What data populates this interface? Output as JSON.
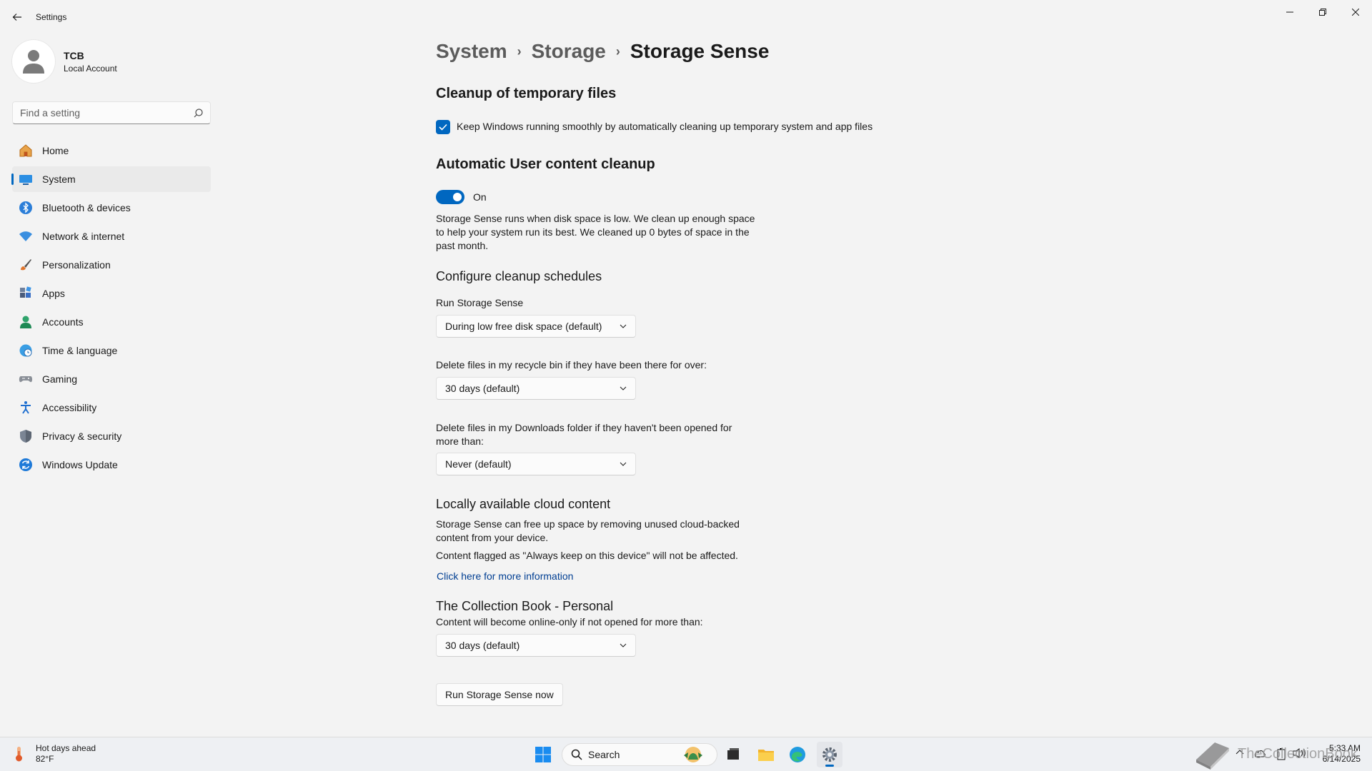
{
  "window": {
    "title": "Settings"
  },
  "profile": {
    "name": "TCB",
    "subtitle": "Local Account"
  },
  "search": {
    "placeholder": "Find a setting"
  },
  "sidebar": {
    "items": [
      {
        "label": "Home"
      },
      {
        "label": "System"
      },
      {
        "label": "Bluetooth & devices"
      },
      {
        "label": "Network & internet"
      },
      {
        "label": "Personalization"
      },
      {
        "label": "Apps"
      },
      {
        "label": "Accounts"
      },
      {
        "label": "Time & language"
      },
      {
        "label": "Gaming"
      },
      {
        "label": "Accessibility"
      },
      {
        "label": "Privacy & security"
      },
      {
        "label": "Windows Update"
      }
    ]
  },
  "breadcrumb": [
    "System",
    "Storage",
    "Storage Sense"
  ],
  "main": {
    "cleanup_title": "Cleanup of temporary files",
    "cleanup_checkbox_label": "Keep Windows running smoothly by automatically cleaning up temporary system and app files",
    "auto_title": "Automatic User content cleanup",
    "toggle_state": "On",
    "auto_desc": "Storage Sense runs when disk space is low. We clean up enough space to help your system run its best. We cleaned up 0 bytes of space in the past month.",
    "schedules_title": "Configure cleanup schedules",
    "run_label": "Run Storage Sense",
    "run_value": "During low free disk space (default)",
    "recycle_label": "Delete files in my recycle bin if they have been there for over:",
    "recycle_value": "30 days (default)",
    "downloads_label": "Delete files in my Downloads folder if they haven't been opened for more than:",
    "downloads_value": "Never (default)",
    "cloud_title": "Locally available cloud content",
    "cloud_desc": "Storage Sense can free up space by removing unused cloud-backed content from your device.",
    "cloud_note": "Content flagged as \"Always keep on this device\" will not be affected.",
    "cloud_link": "Click here for more information",
    "collection_title": "The Collection Book - Personal",
    "collection_label": "Content will become online-only if not opened for more than:",
    "collection_value": "30 days (default)",
    "run_now_button": "Run Storage Sense now"
  },
  "taskbar": {
    "weather_title": "Hot days ahead",
    "weather_temp": "82°F",
    "search_label": "Search",
    "time": "5:33 AM",
    "date": "6/14/2025",
    "watermark": "TheCollectionBook"
  },
  "colors": {
    "accent": "#0067c0",
    "link": "#003e92",
    "background": "#f3f3f3"
  }
}
